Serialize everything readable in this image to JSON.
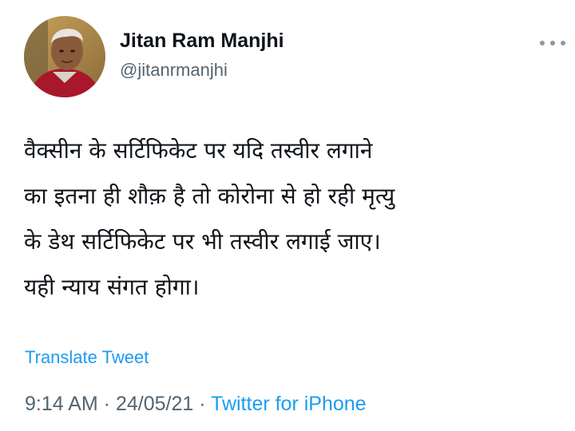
{
  "tweet": {
    "author": {
      "name": "Jitan Ram Manjhi",
      "handle": "@jitanrmanjhi"
    },
    "more_icon": "more-horizontal-icon",
    "text_lines": [
      "वैक्सीन के सर्टिफिकेट पर यदि तस्वीर लगाने",
      "का इतना ही शौक़ है तो कोरोना से हो रही मृत्यु",
      "के डेथ सर्टिफिकेट पर भी तस्वीर लगाई जाए।",
      "यही न्याय संगत होगा।"
    ],
    "translate_label": "Translate Tweet",
    "time": "9:14 AM",
    "separator": " · ",
    "date": "24/05/21",
    "source": "Twitter for iPhone"
  },
  "colors": {
    "text_primary": "#0f1419",
    "text_secondary": "#536471",
    "link": "#1d9bf0",
    "background": "#ffffff"
  }
}
